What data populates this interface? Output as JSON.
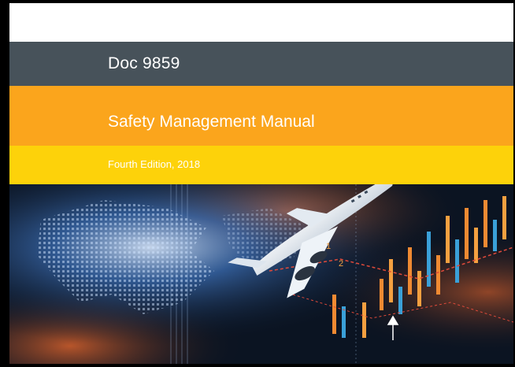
{
  "cover": {
    "doc_number": "Doc 9859",
    "title": "Safety Management Manual",
    "edition": "Fourth Edition, 2018"
  },
  "colors": {
    "doc_band": "#47525a",
    "title_band": "#fba51c",
    "edition_band": "#fdd20a",
    "text": "#ffffff"
  },
  "image": {
    "description_icon": "airplane-over-world-map-and-chart"
  }
}
